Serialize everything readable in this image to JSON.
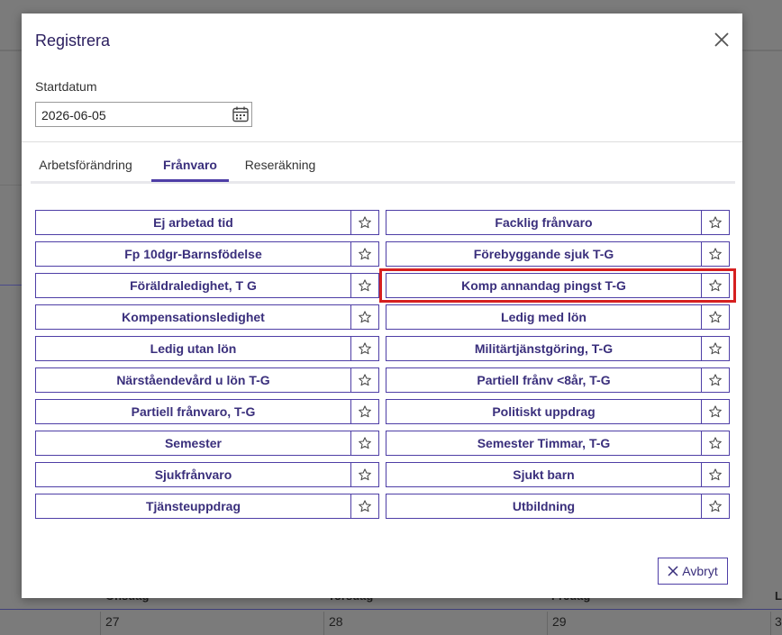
{
  "background": {
    "days": [
      {
        "name": "Onsdag",
        "num": "27"
      },
      {
        "name": "Torsdag",
        "num": "28"
      },
      {
        "name": "Fredag",
        "num": "29"
      },
      {
        "name": "L",
        "num": "3"
      }
    ]
  },
  "modal": {
    "title": "Registrera",
    "start_date_label": "Startdatum",
    "start_date_value": "2026-06-05",
    "tabs": [
      {
        "label": "Arbetsförändring",
        "active": false
      },
      {
        "label": "Frånvaro",
        "active": true
      },
      {
        "label": "Reseräkning",
        "active": false
      }
    ],
    "left_items": [
      "Ej arbetad tid",
      "Fp 10dgr-Barnsfödelse",
      "Föräldraledighet, T G",
      "Kompensationsledighet",
      "Ledig utan lön",
      "Närståendevård u lön T-G",
      "Partiell frånvaro, T-G",
      "Semester",
      "Sjukfrånvaro",
      "Tjänsteuppdrag"
    ],
    "right_items": [
      "Facklig frånvaro",
      "Förebyggande sjuk T-G",
      "Komp annandag pingst T-G",
      "Ledig med lön",
      "Militärtjänstgöring, T-G",
      "Partiell frånv <8år, T-G",
      "Politiskt uppdrag",
      "Semester Timmar, T-G",
      "Sjukt barn",
      "Utbildning"
    ],
    "highlighted_item": "Komp annandag pingst T-G",
    "cancel_label": "Avbryt"
  },
  "colors": {
    "accent": "#4e3ea6",
    "text_accent": "#3a2f7c",
    "highlight": "#d62020"
  },
  "icons": {
    "close": "close-icon",
    "calendar": "calendar-icon",
    "favorite": "star-outline-icon",
    "cancel": "x-icon"
  }
}
